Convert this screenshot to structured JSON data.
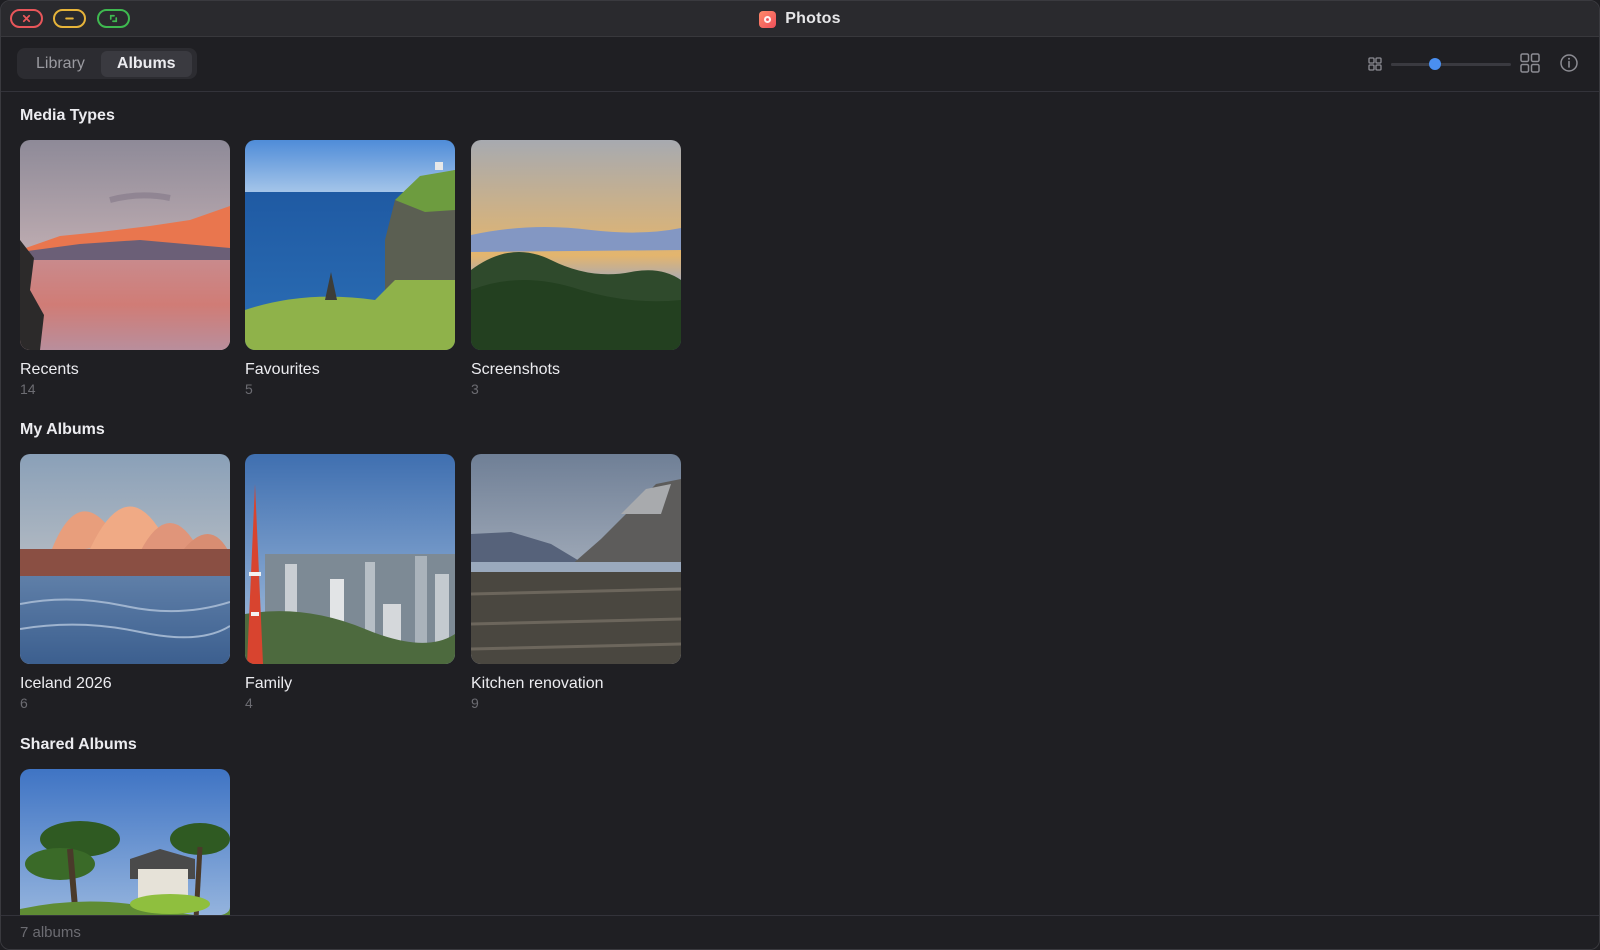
{
  "window": {
    "title": "Photos",
    "app_icon": "photos-app-icon",
    "controls": [
      "close-icon",
      "minimize-icon",
      "fullscreen-icon"
    ]
  },
  "toolbar": {
    "tabs": [
      {
        "label": "Library",
        "active": false
      },
      {
        "label": "Albums",
        "active": true
      }
    ],
    "zoom_slider": {
      "value": 0.35
    },
    "icons": [
      "small-grid-icon",
      "large-grid-icon",
      "info-icon"
    ],
    "accent_color": "#4a8ff0"
  },
  "sections": {
    "media_types": {
      "title": "Media Types",
      "albums": [
        {
          "name": "Recents",
          "count": "14",
          "image": "sunset-lake-mountains"
        },
        {
          "name": "Favourites",
          "count": "5",
          "image": "sea-cliffs"
        },
        {
          "name": "Screenshots",
          "count": "3",
          "image": "misty-hills-sunset"
        }
      ]
    },
    "my_albums": {
      "title": "My Albums",
      "albums": [
        {
          "name": "Iceland 2026",
          "count": "6",
          "image": "opera-house-harbour"
        },
        {
          "name": "Family",
          "count": "4",
          "image": "city-skyline-tower"
        },
        {
          "name": "Kitchen renovation",
          "count": "9",
          "image": "alpine-valley-town"
        }
      ]
    },
    "shared_albums": {
      "title": "Shared Albums",
      "albums": [
        {
          "name": "",
          "count": "",
          "image": "japanese-garden-pines"
        }
      ]
    }
  },
  "footer": {
    "summary": "7 albums"
  }
}
